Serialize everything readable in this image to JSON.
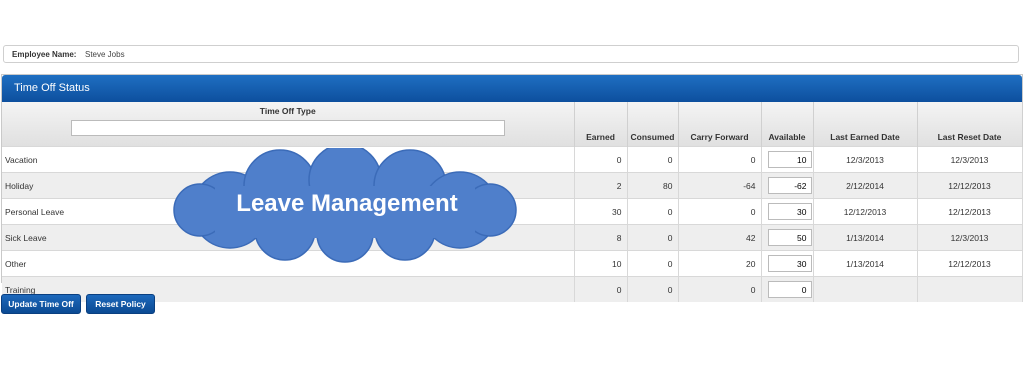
{
  "employee": {
    "label": "Employee Name:",
    "value": "Steve Jobs"
  },
  "panel": {
    "title": "Time Off Status"
  },
  "table": {
    "headers": {
      "type": "Time Off Type",
      "earned": "Earned",
      "consumed": "Consumed",
      "carry_forward": "Carry Forward",
      "available": "Available",
      "last_earned": "Last Earned Date",
      "last_reset": "Last Reset Date"
    },
    "type_filter_value": "",
    "rows": [
      {
        "type": "Vacation",
        "earned": "0",
        "consumed": "0",
        "carry_forward": "0",
        "available": "10",
        "last_earned": "12/3/2013",
        "last_reset": "12/3/2013"
      },
      {
        "type": "Holiday",
        "earned": "2",
        "consumed": "80",
        "carry_forward": "-64",
        "available": "-62",
        "last_earned": "2/12/2014",
        "last_reset": "12/12/2013"
      },
      {
        "type": "Personal Leave",
        "earned": "30",
        "consumed": "0",
        "carry_forward": "0",
        "available": "30",
        "last_earned": "12/12/2013",
        "last_reset": "12/12/2013"
      },
      {
        "type": "Sick Leave",
        "earned": "8",
        "consumed": "0",
        "carry_forward": "42",
        "available": "50",
        "last_earned": "1/13/2014",
        "last_reset": "12/3/2013"
      },
      {
        "type": "Other",
        "earned": "10",
        "consumed": "0",
        "carry_forward": "20",
        "available": "30",
        "last_earned": "1/13/2014",
        "last_reset": "12/12/2013"
      },
      {
        "type": "Training",
        "earned": "0",
        "consumed": "0",
        "carry_forward": "0",
        "available": "0",
        "last_earned": "",
        "last_reset": ""
      }
    ]
  },
  "buttons": {
    "update": "Update Time Off",
    "reset": "Reset Policy"
  },
  "overlay": {
    "text": "Leave Management",
    "color": "#4f7fcb"
  },
  "colors": {
    "header_blue": "#0d4f9e",
    "button_blue": "#0b4a93"
  }
}
